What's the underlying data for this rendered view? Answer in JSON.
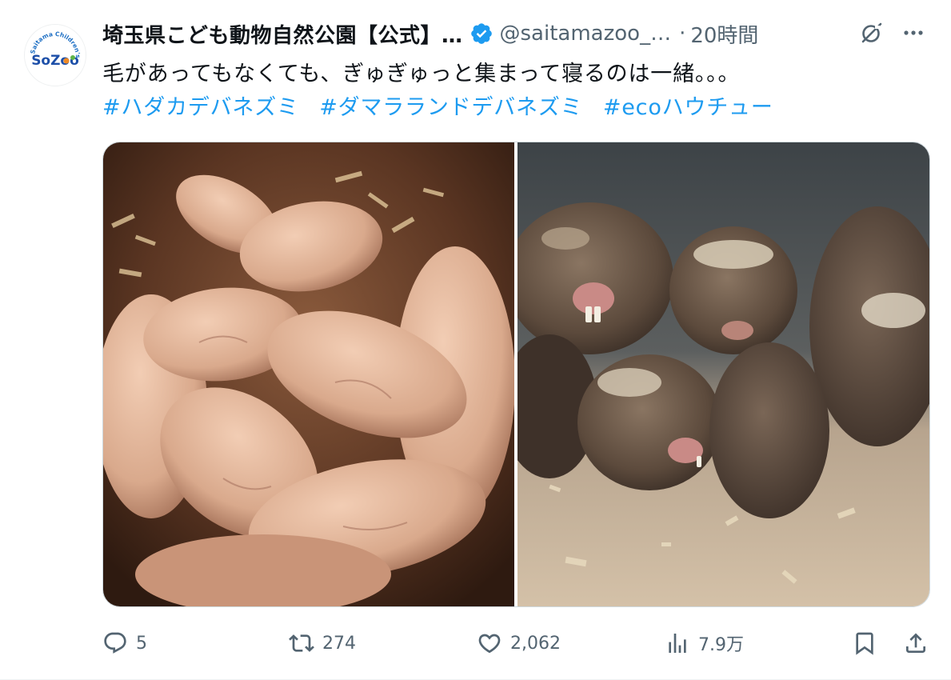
{
  "tweet": {
    "author": {
      "display_name": "埼玉県こども動物自然公園【公式】…",
      "handle": "@saitamazoo_…",
      "verified": true,
      "avatar_logo_text": "SoZoo",
      "avatar_ring_text": "Saitama Children's Zoo"
    },
    "separator": "·",
    "time": "20時間",
    "text": "毛があってもなくても、ぎゅぎゅっと集まって寝るのは一緒。。。",
    "hashtags": [
      "#ハダカデバネズミ",
      "#ダマラランドデバネズミ",
      "#ecoハウチュー"
    ],
    "media": [
      {
        "subject": "naked mole-rats huddled together"
      },
      {
        "subject": "Damaraland mole-rats huddled together"
      }
    ],
    "actions": {
      "replies": "5",
      "retweets": "274",
      "likes": "2,062",
      "views": "7.9万"
    }
  },
  "colors": {
    "accent": "#1d9bf0",
    "text": "#0f1419",
    "secondary_text": "#536471",
    "border": "#cfd9de"
  }
}
